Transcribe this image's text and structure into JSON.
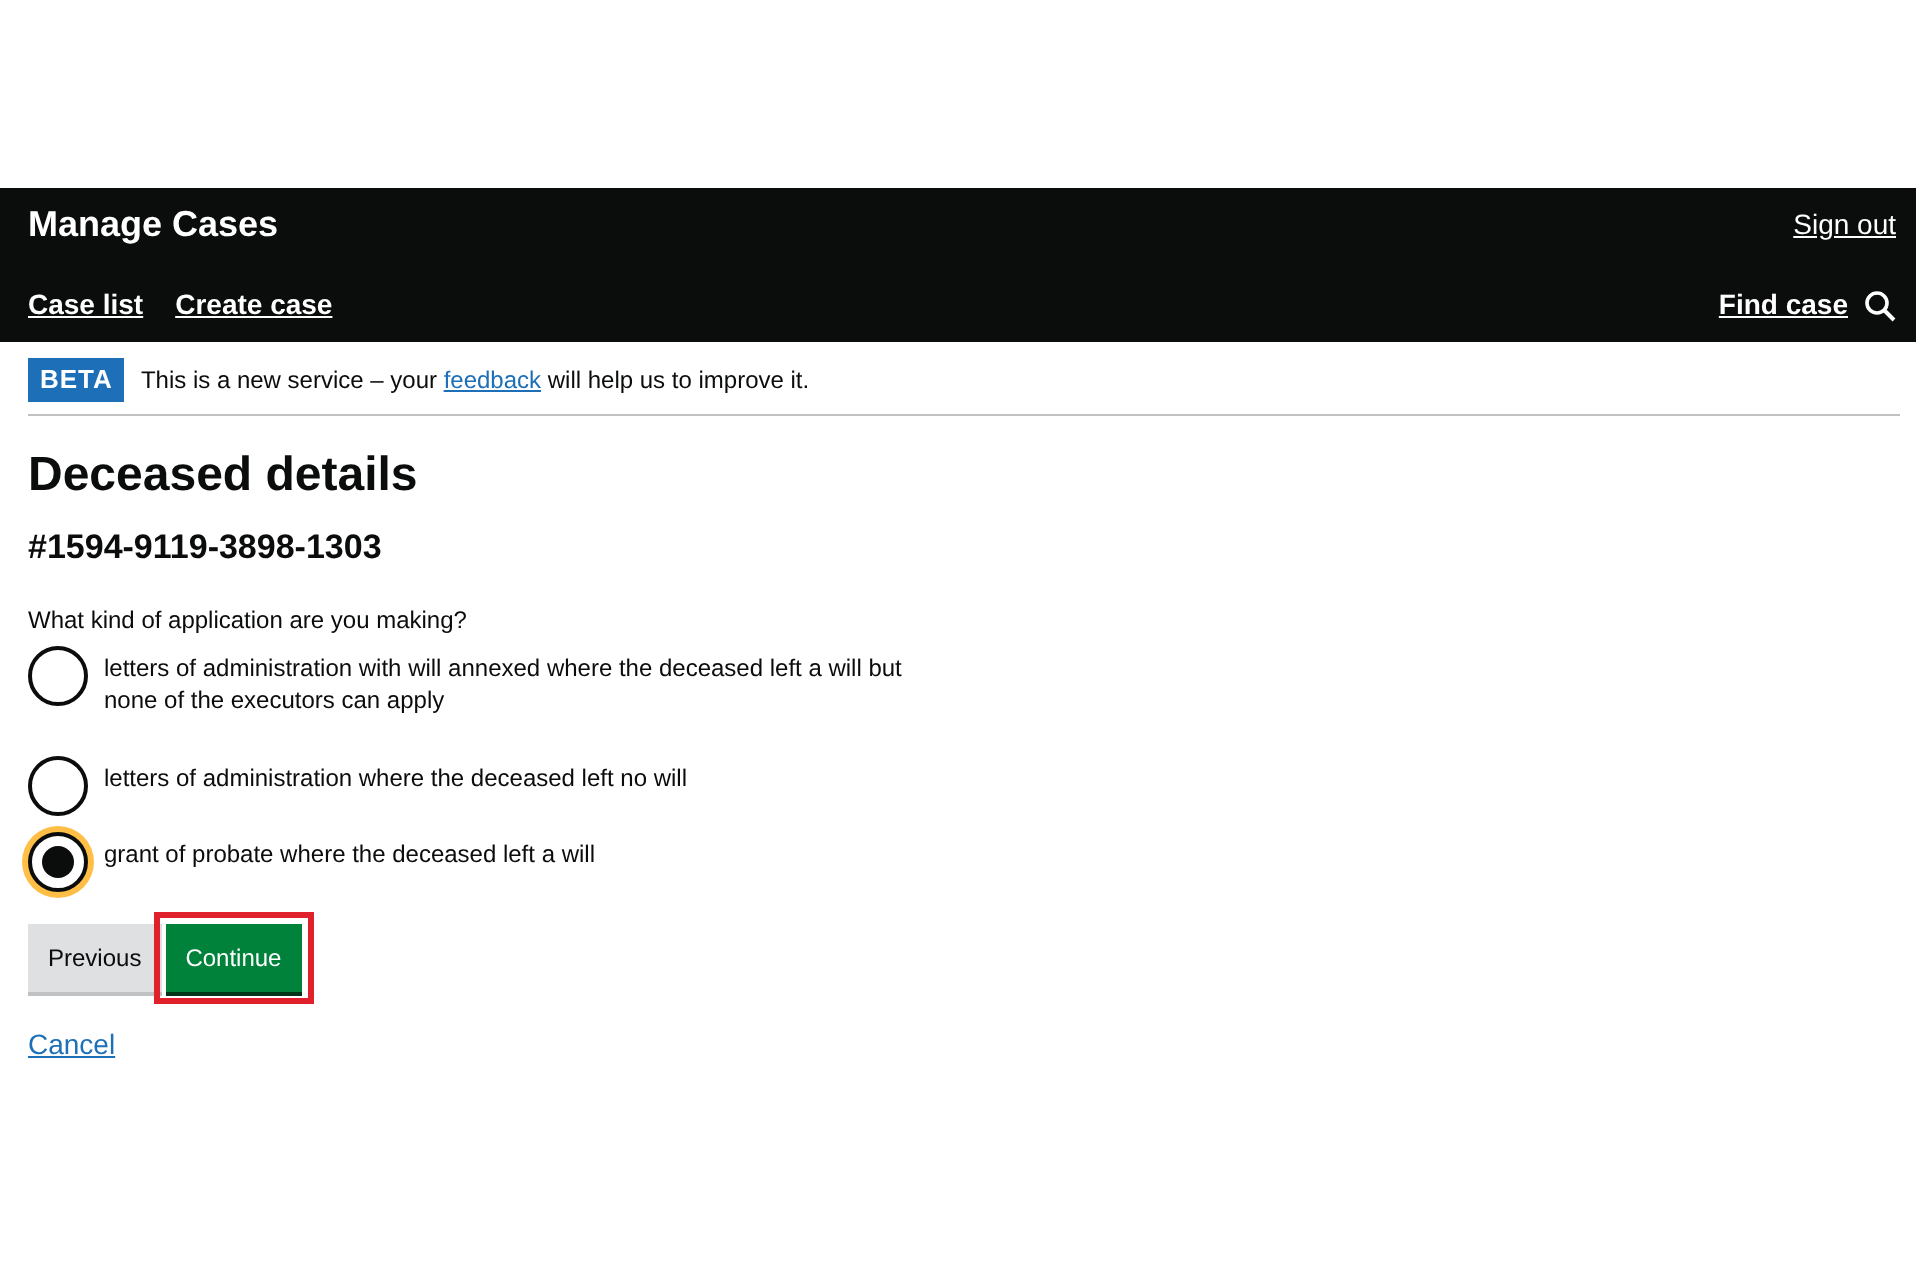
{
  "header": {
    "title": "Manage Cases",
    "sign_out": "Sign out",
    "nav": [
      {
        "label": "Case list"
      },
      {
        "label": "Create case"
      }
    ],
    "find_case": "Find case"
  },
  "phase_banner": {
    "tag": "BETA",
    "text_before": "This is a new service – your ",
    "link": "feedback",
    "text_after": " will help us to improve it."
  },
  "page": {
    "title": "Deceased details",
    "case_number": "#1594-9119-3898-1303"
  },
  "question": {
    "label": "What kind of application are you making?",
    "options": [
      {
        "label": "letters of administration with will annexed where the deceased left a will but none of the executors can apply",
        "selected": false,
        "focused": false
      },
      {
        "label": "letters of administration where the deceased left no will",
        "selected": false,
        "focused": false
      },
      {
        "label": "grant of probate where the deceased left a will",
        "selected": true,
        "focused": true
      }
    ]
  },
  "buttons": [
    {
      "kind": "secondary",
      "label": "Previous",
      "highlighted": false
    },
    {
      "kind": "primary",
      "label": "Continue",
      "highlighted": true
    }
  ],
  "cancel": "Cancel"
}
